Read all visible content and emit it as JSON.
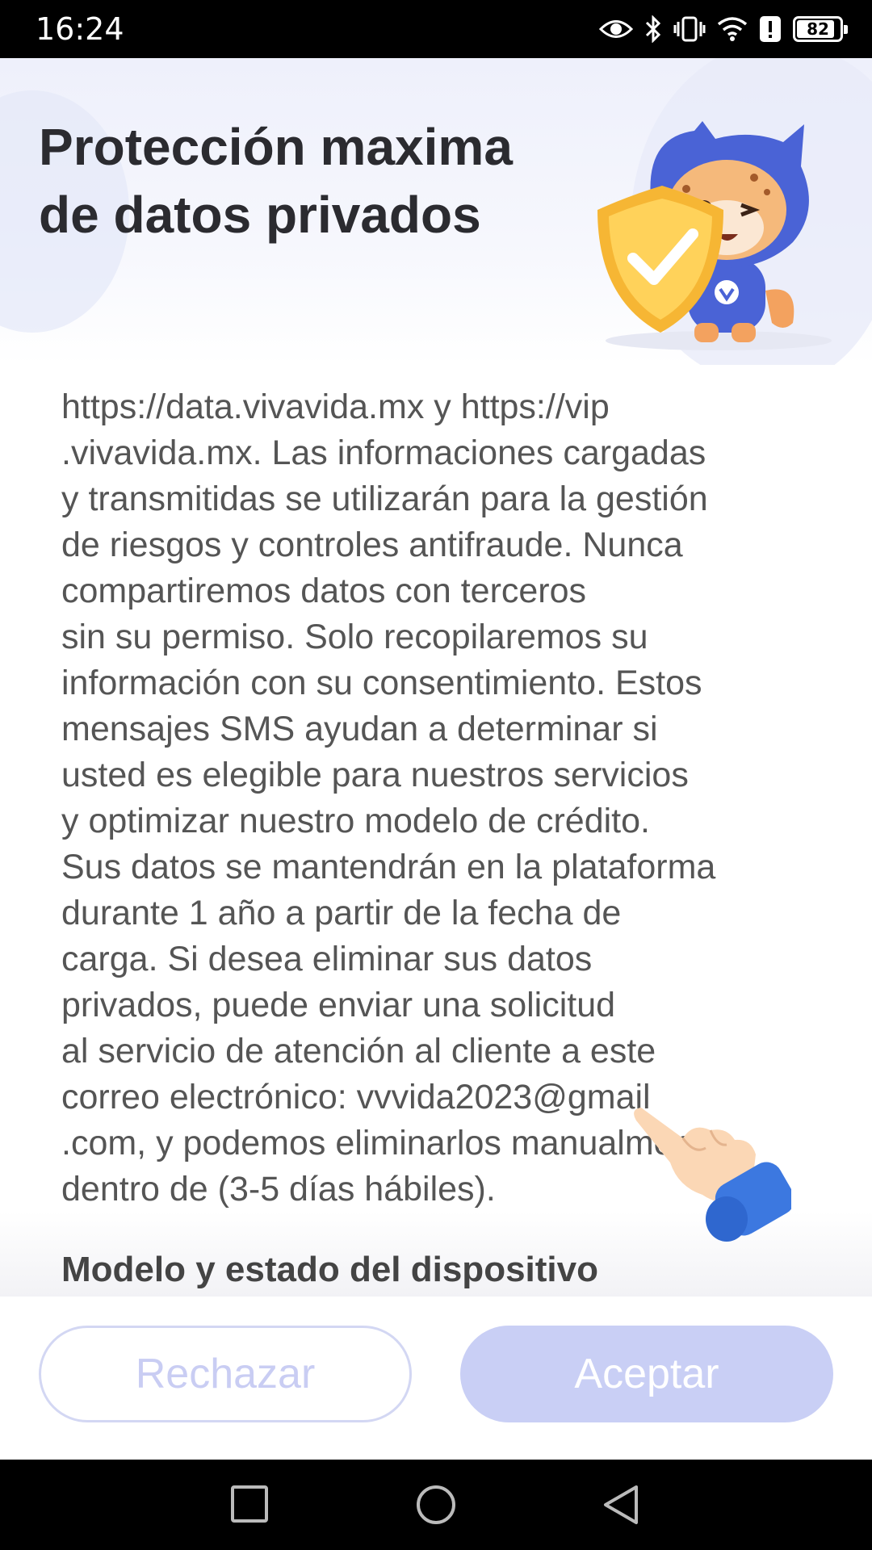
{
  "status_bar": {
    "time": "16:24",
    "battery_level": "82",
    "icons": [
      "eye-icon",
      "bluetooth-icon",
      "vibrate-icon",
      "wifi-icon",
      "alert-icon",
      "battery-icon"
    ]
  },
  "header": {
    "title_line1": "Protección maxima",
    "title_line2": "de datos privados"
  },
  "content": {
    "paragraph": "https://data.vivavida.mx y https://vip\n.vivavida.mx. Las informaciones cargadas\ny transmitidas se utilizarán para la gestión\nde riesgos y controles antifraude. Nunca\ncompartiremos datos con terceros\nsin su permiso. Solo recopilaremos su\ninformación con su consentimiento. Estos\nmensajes SMS ayudan a determinar si\nusted es elegible para nuestros servicios\ny optimizar nuestro modelo de crédito.\nSus datos se mantendrán en la plataforma\ndurante 1 año a partir de la fecha de\ncarga. Si desea eliminar sus datos\nprivados, puede enviar una solicitud\nal servicio de atención al cliente a este\ncorreo electrónico: vvvida2023@gmail\n.com, y podemos eliminarlos manualmente\ndentro de (3-5 días hábiles).",
    "next_section_heading": "Modelo y estado del dispositivo"
  },
  "footer": {
    "reject_label": "Rechazar",
    "accept_label": "Aceptar"
  },
  "colors": {
    "accent_light": "#c9cff5",
    "reject_border": "#d3d7f3",
    "mascot_blue": "#4a63d6",
    "shield_gold": "#f6b634"
  }
}
